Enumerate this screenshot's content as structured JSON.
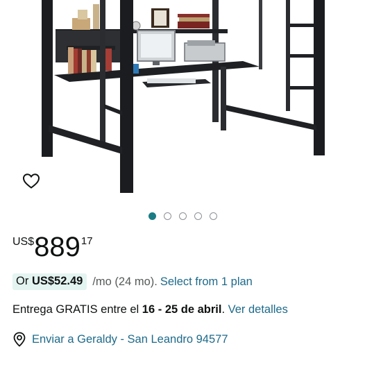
{
  "colors": {
    "accent_teal": "#1a7c84",
    "link_blue": "#1d6a8a",
    "installment_bg": "#e3f4f1",
    "text_dark": "#0f1111",
    "text_muted": "#565959"
  },
  "carousel": {
    "total_images": 5,
    "active_index": 0
  },
  "wishlist": {
    "icon": "heart-outline-icon"
  },
  "price": {
    "currency": "US$",
    "whole": "889",
    "fraction": "17"
  },
  "installment": {
    "prefix": "Or",
    "amount": "US$52.49",
    "term": "/mo (24 mo).",
    "link": "Select from 1 plan"
  },
  "delivery": {
    "prefix": "Entrega GRATIS entre el",
    "dates": "16 - 25 de abril",
    "period": ".",
    "link": "Ver detalles"
  },
  "location": {
    "icon": "location-pin-icon",
    "text": "Enviar a Geraldy - San Leandro 94577"
  }
}
